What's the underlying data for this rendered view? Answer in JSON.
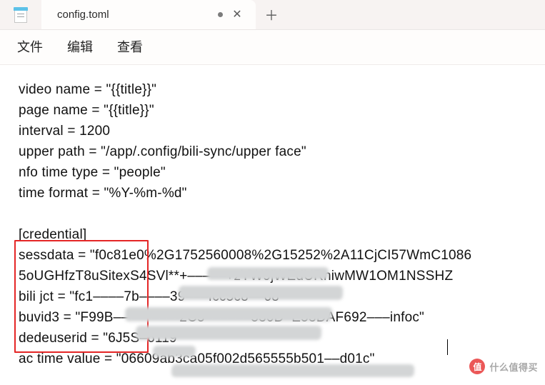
{
  "app": {
    "icon_name": "notepad-icon"
  },
  "tab": {
    "title": "config.toml",
    "dirty": true
  },
  "menubar": {
    "items": [
      "文件",
      "编辑",
      "查看"
    ]
  },
  "editor": {
    "lines": [
      "video name = \"{{title}}\"",
      "page name = \"{{title}}\"",
      "interval = 1200",
      "upper path = \"/app/.config/bili-sync/upper face\"",
      "nfo time type = \"people\"",
      "time format = \"%Y-%m-%d\"",
      "",
      "[credential]",
      "sessdata = \"f0c81e0%2G1752560008%2G15252%2A11CjCI57WmC1086",
      "5oUGHfzT8uSitexS4SVl**+–––––+zYW9jWEdURniwMW1OM1NSSHZ",
      "bili jct = \"fc1––––7b––––39–––fcc5c8––68\"",
      "buvid3 = \"F99B––––––––-2C5––––––530D–E53DAF692–––infoc\"",
      "dedeuserid = \"6J5S–6119\"",
      "ac time value = \"06609ab3ca05f002d565555b501––d01c\""
    ]
  },
  "highlight": {
    "label": "credential-keys-box"
  },
  "watermark": {
    "site": "什么值得买",
    "logo_char": "值"
  }
}
